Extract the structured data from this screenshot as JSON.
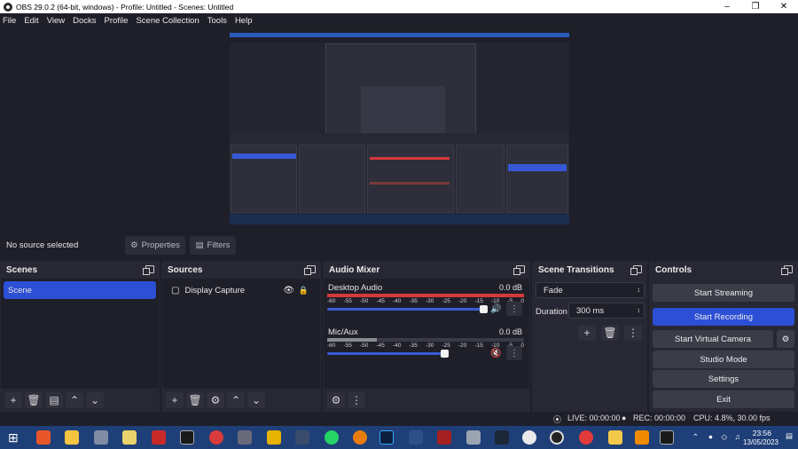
{
  "window": {
    "title": "OBS 29.0.2 (64-bit, windows) - Profile: Untitled - Scenes: Untitled"
  },
  "menu": [
    "File",
    "Edit",
    "View",
    "Docks",
    "Profile",
    "Scene Collection",
    "Tools",
    "Help"
  ],
  "info": {
    "no_source": "No source selected",
    "properties": "Properties",
    "filters": "Filters"
  },
  "scenes": {
    "title": "Scenes",
    "items": [
      "Scene"
    ]
  },
  "sources": {
    "title": "Sources",
    "items": [
      "Display Capture"
    ]
  },
  "mixer": {
    "title": "Audio Mixer",
    "scale": [
      "-60",
      "-55",
      "-50",
      "-45",
      "-40",
      "-35",
      "-30",
      "-25",
      "-20",
      "-15",
      "-10",
      "-5",
      "0"
    ],
    "channels": [
      {
        "name": "Desktop Audio",
        "db": "0.0 dB",
        "level": 1.0,
        "muted": false
      },
      {
        "name": "Mic/Aux",
        "db": "0.0 dB",
        "level": 0.75,
        "muted": true
      }
    ]
  },
  "transitions": {
    "title": "Scene Transitions",
    "selected": "Fade",
    "duration_label": "Duration",
    "duration": "300 ms"
  },
  "controls": {
    "title": "Controls",
    "start_streaming": "Start Streaming",
    "start_recording": "Start Recording",
    "start_virtual_camera": "Start Virtual Camera",
    "studio_mode": "Studio Mode",
    "settings": "Settings",
    "exit": "Exit"
  },
  "status": {
    "live": "LIVE: 00:00:00",
    "rec": "REC: 00:00:00",
    "cpu": "CPU: 4.8%, 30.00 fps"
  },
  "taskbar": {
    "time": "23:56",
    "date": "13/05/2023"
  },
  "colors": {
    "accent": "#2c4fd6",
    "bg": "#1e1f29",
    "dock": "#272833",
    "meter_red": "#d43a3a"
  }
}
